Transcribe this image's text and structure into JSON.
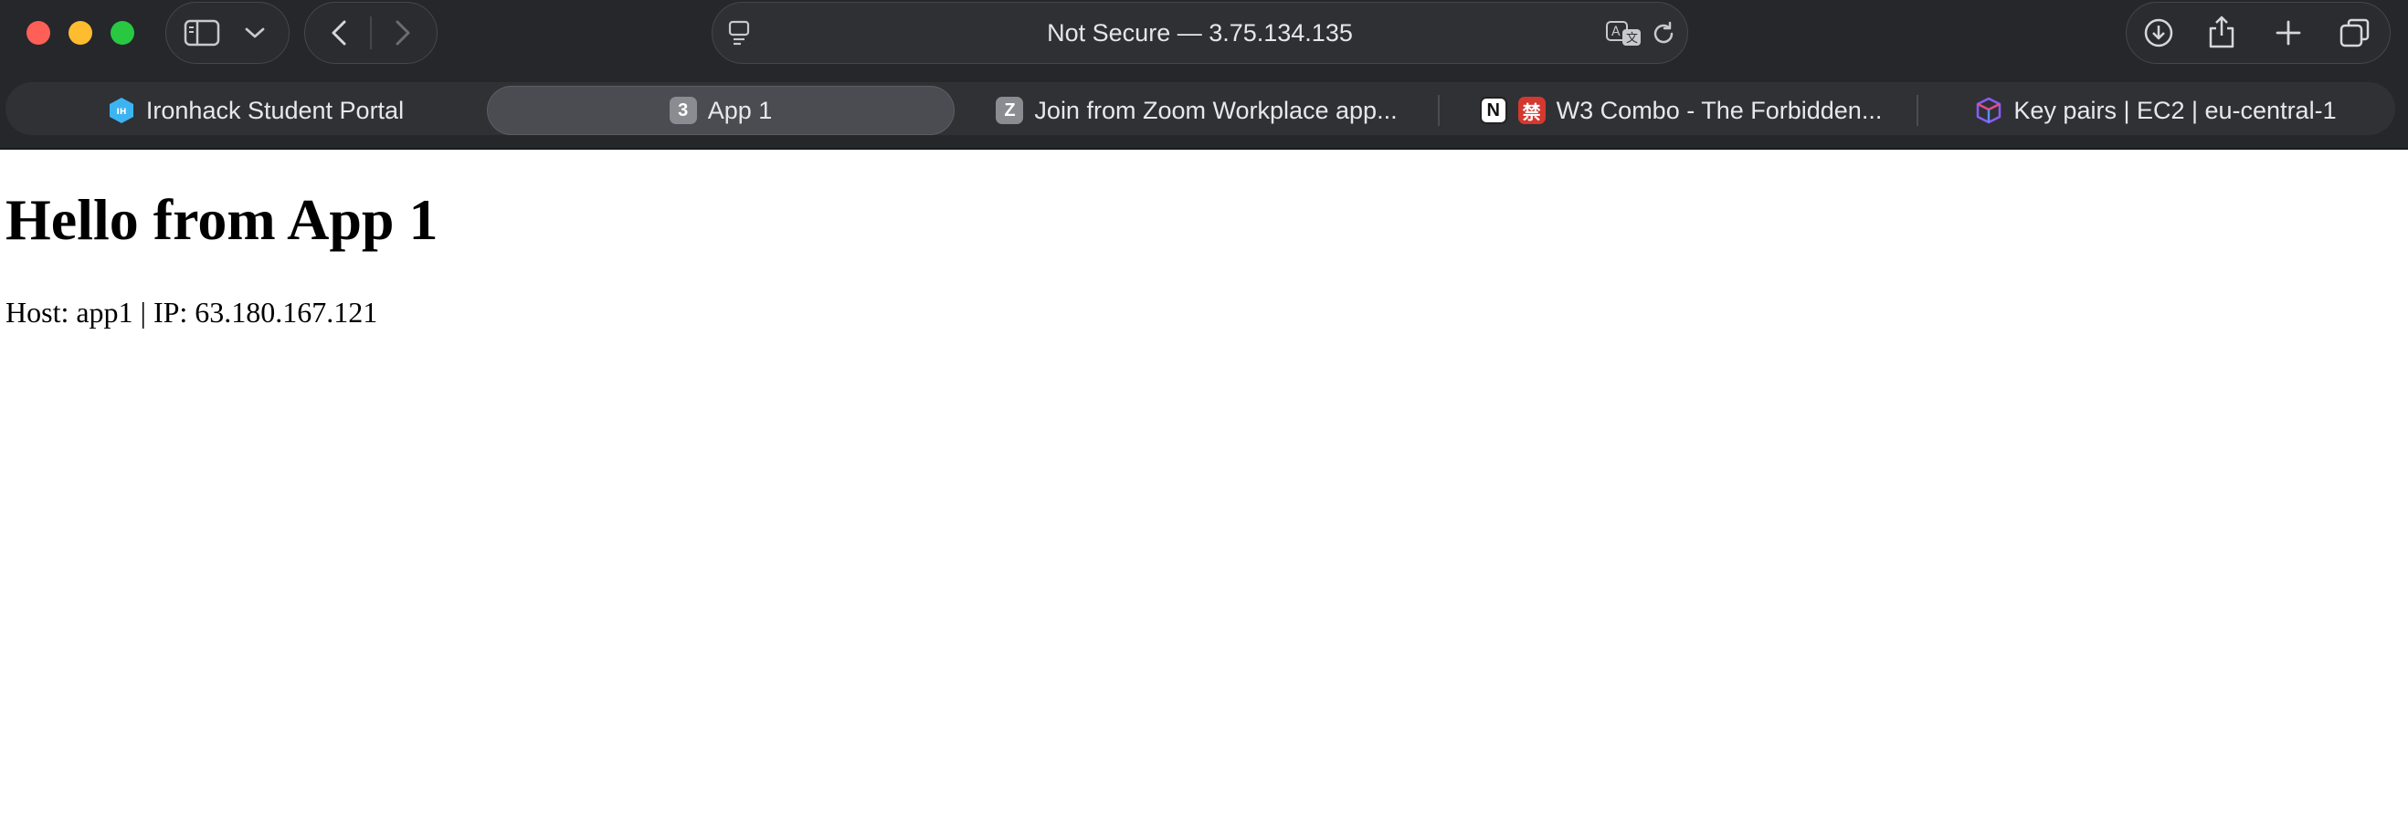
{
  "browser": {
    "address_bar": {
      "text": "Not Secure — 3.75.134.135"
    },
    "tabs": [
      {
        "label": "Ironhack Student Portal",
        "favicon": "ironhack-icon",
        "favicon_color": "#2fa8f0",
        "active": false
      },
      {
        "label": "App 1",
        "favicon_text": "3",
        "favicon_color": "#8a8c91",
        "active": true
      },
      {
        "label": "Join from Zoom Workplace app...",
        "favicon_text": "Z",
        "favicon_color": "#8a8c91",
        "active": false
      },
      {
        "label": "W3 Combo - The Forbidden...",
        "favicon": "notion-icon",
        "favicon2_text": "禁",
        "favicon2_color": "#d4382f",
        "active": false
      },
      {
        "label": "Key pairs | EC2 | eu-central-1",
        "favicon": "cube-icon",
        "favicon_color": "#8a5cf6",
        "active": false
      }
    ]
  },
  "page": {
    "heading": "Hello from App 1",
    "info": "Host: app1 | IP: 63.180.167.121"
  },
  "colors": {
    "chrome_bg": "#25272b",
    "close": "#fe5f57",
    "minimize": "#febc2e",
    "maximize": "#28c840"
  }
}
